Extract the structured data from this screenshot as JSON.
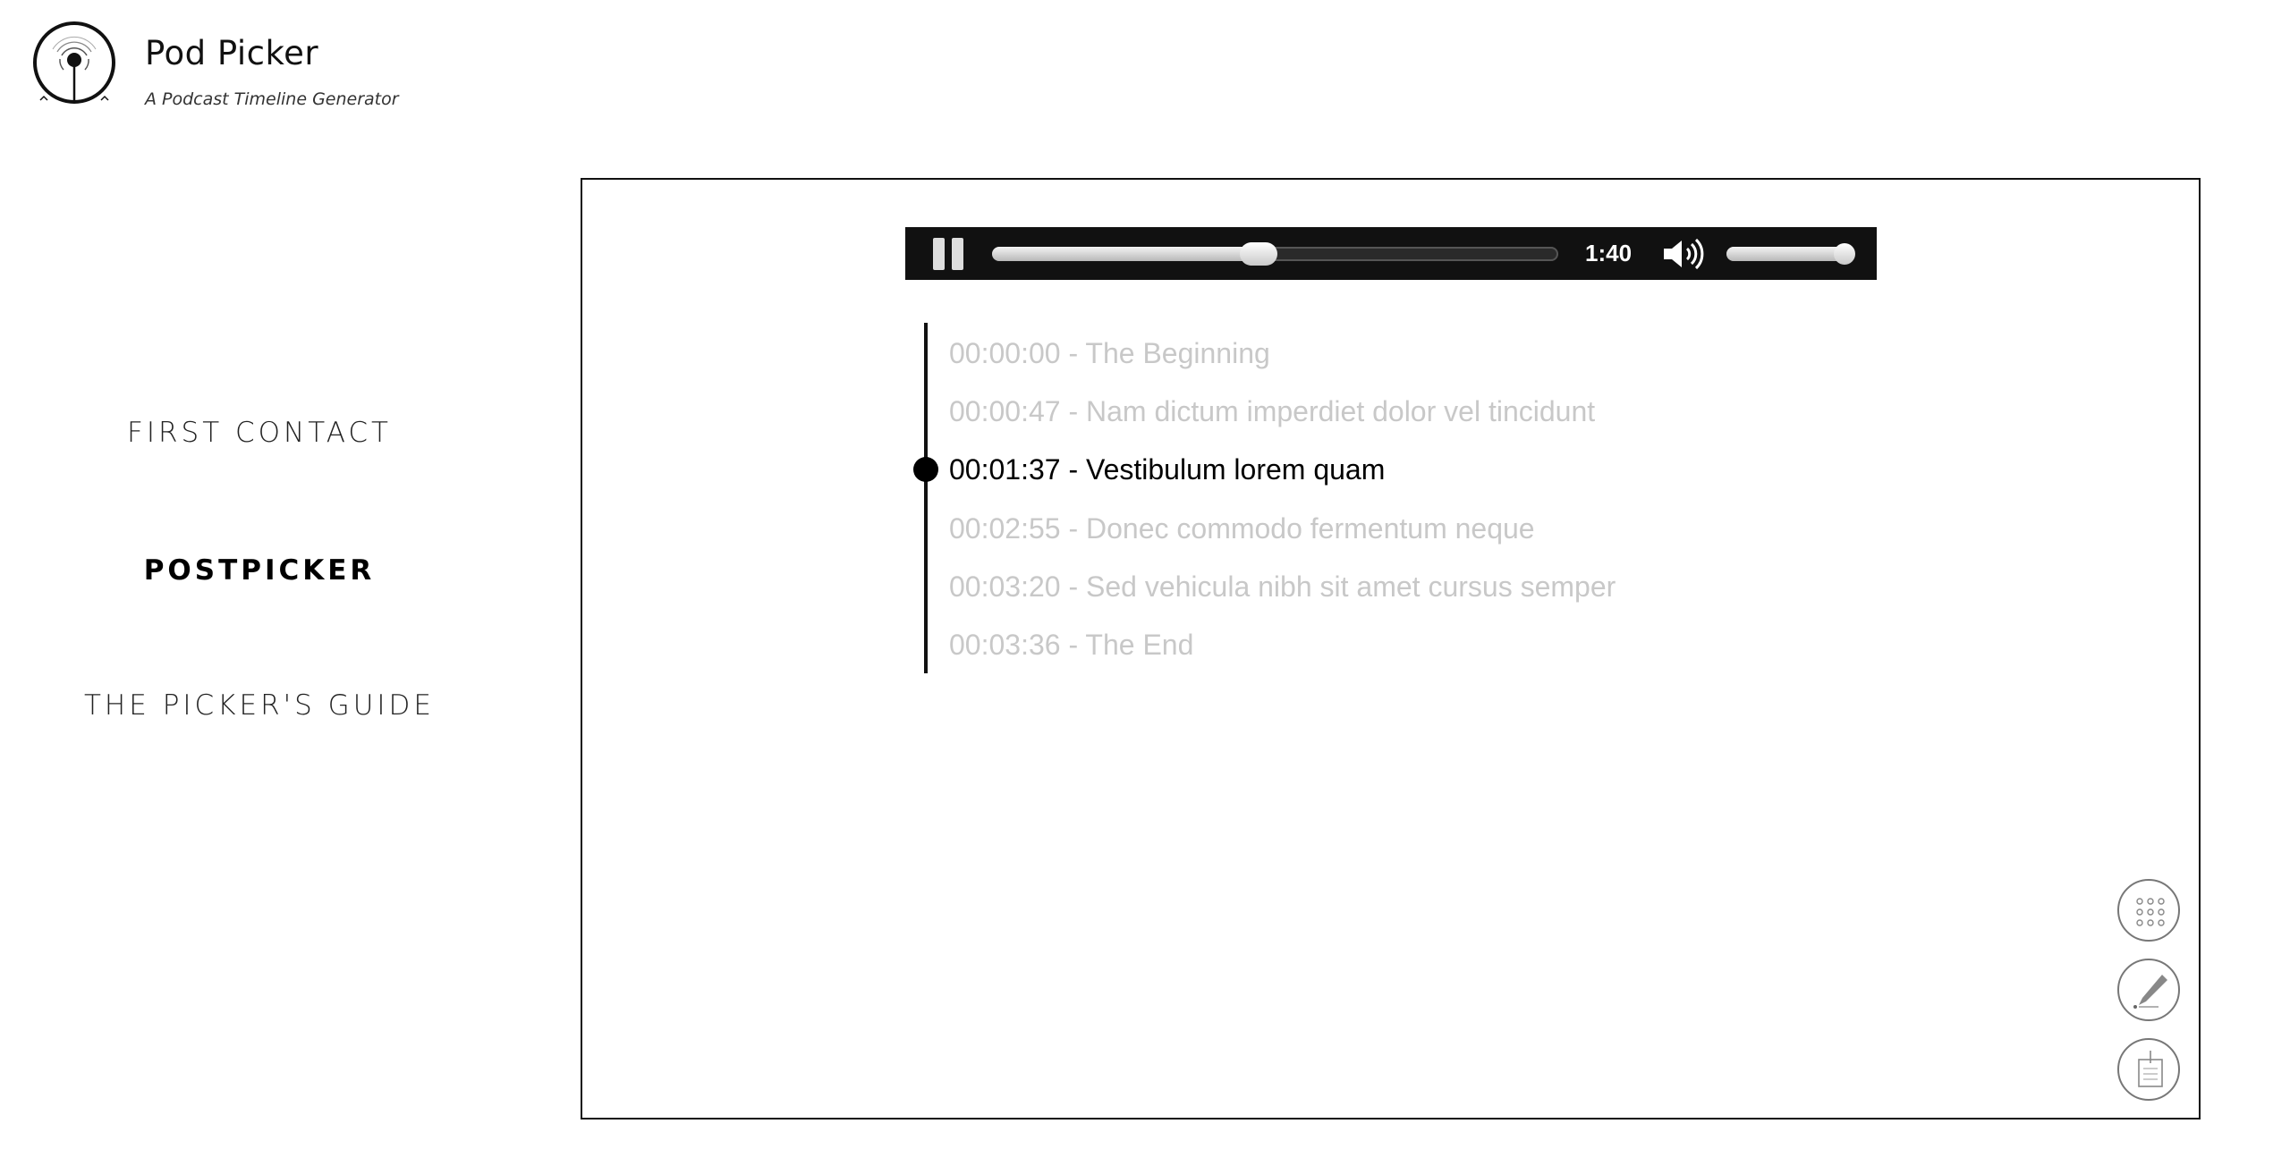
{
  "brand": {
    "title": "Pod Picker",
    "subtitle": "A Podcast Timeline Generator",
    "logo_icon": "podcast-antenna-icon"
  },
  "nav": {
    "items": [
      {
        "label": "FIRST CONTACT",
        "active": false
      },
      {
        "label": "POSTPICKER",
        "active": true
      },
      {
        "label": "THE PICKER'S GUIDE",
        "active": false
      }
    ]
  },
  "player": {
    "state": "playing",
    "play_pause_icon": "pause-icon",
    "current_time": "1:40",
    "progress_fraction": 0.47,
    "volume_icon": "speaker-volume-icon",
    "volume_fraction": 0.94
  },
  "timeline": {
    "current_index": 2,
    "items": [
      {
        "text": "00:00:00 - The Beginning"
      },
      {
        "text": "00:00:47 - Nam dictum imperdiet dolor vel tincidunt"
      },
      {
        "text": "00:01:37 - Vestibulum lorem quam"
      },
      {
        "text": "00:02:55 - Donec commodo fermentum neque"
      },
      {
        "text": "00:03:20 - Sed vehicula nibh sit amet cursus semper"
      },
      {
        "text": "00:03:36 - The End"
      }
    ]
  },
  "actions": [
    {
      "icon": "grid-dots-icon"
    },
    {
      "icon": "pen-edit-icon"
    },
    {
      "icon": "clipboard-icon"
    }
  ],
  "colors": {
    "inactive_text": "#c8c8c8",
    "active_text": "#000000",
    "player_bg": "#111111"
  }
}
